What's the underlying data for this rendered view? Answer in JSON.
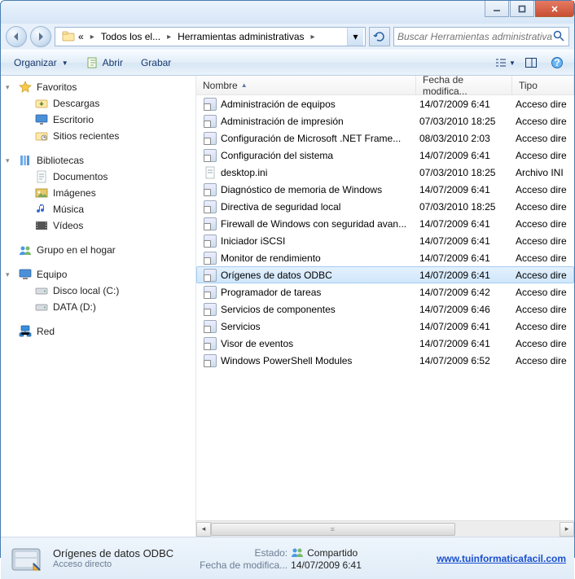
{
  "titlebar": {
    "min": "min",
    "max": "max",
    "close": "close"
  },
  "address": {
    "root_hint": "«",
    "seg1": "Todos los el...",
    "seg2": "Herramientas administrativas"
  },
  "search": {
    "placeholder": "Buscar Herramientas administrativas"
  },
  "toolbar": {
    "organize": "Organizar",
    "open": "Abrir",
    "burn": "Grabar"
  },
  "nav": {
    "favorites": "Favoritos",
    "downloads": "Descargas",
    "desktop": "Escritorio",
    "recent": "Sitios recientes",
    "libraries": "Bibliotecas",
    "documents": "Documentos",
    "images": "Imágenes",
    "music": "Música",
    "videos": "Vídeos",
    "homegroup": "Grupo en el hogar",
    "computer": "Equipo",
    "localdisk": "Disco local (C:)",
    "datad": "DATA (D:)",
    "network": "Red"
  },
  "columns": {
    "name": "Nombre",
    "date": "Fecha de modifica...",
    "type": "Tipo"
  },
  "col_widths": {
    "name": 270,
    "date": 118,
    "type": 80
  },
  "rows": [
    {
      "name": "Administración de equipos",
      "date": "14/07/2009 6:41",
      "type": "Acceso dire"
    },
    {
      "name": "Administración de impresión",
      "date": "07/03/2010 18:25",
      "type": "Acceso dire"
    },
    {
      "name": "Configuración de Microsoft .NET Frame...",
      "date": "08/03/2010 2:03",
      "type": "Acceso dire"
    },
    {
      "name": "Configuración del sistema",
      "date": "14/07/2009 6:41",
      "type": "Acceso dire"
    },
    {
      "name": "desktop.ini",
      "date": "07/03/2010 18:25",
      "type": "Archivo INI",
      "plain": true
    },
    {
      "name": "Diagnóstico de memoria de Windows",
      "date": "14/07/2009 6:41",
      "type": "Acceso dire"
    },
    {
      "name": "Directiva de seguridad local",
      "date": "07/03/2010 18:25",
      "type": "Acceso dire"
    },
    {
      "name": "Firewall de Windows con seguridad avan...",
      "date": "14/07/2009 6:41",
      "type": "Acceso dire"
    },
    {
      "name": "Iniciador iSCSI",
      "date": "14/07/2009 6:41",
      "type": "Acceso dire"
    },
    {
      "name": "Monitor de rendimiento",
      "date": "14/07/2009 6:41",
      "type": "Acceso dire"
    },
    {
      "name": "Orígenes de datos ODBC",
      "date": "14/07/2009 6:41",
      "type": "Acceso dire",
      "selected": true
    },
    {
      "name": "Programador de tareas",
      "date": "14/07/2009 6:42",
      "type": "Acceso dire"
    },
    {
      "name": "Servicios de componentes",
      "date": "14/07/2009 6:46",
      "type": "Acceso dire"
    },
    {
      "name": "Servicios",
      "date": "14/07/2009 6:41",
      "type": "Acceso dire"
    },
    {
      "name": "Visor de eventos",
      "date": "14/07/2009 6:41",
      "type": "Acceso dire"
    },
    {
      "name": "Windows PowerShell Modules",
      "date": "14/07/2009 6:52",
      "type": "Acceso dire"
    }
  ],
  "details": {
    "title": "Orígenes de datos ODBC",
    "sub": "Acceso directo",
    "state_lbl": "Estado:",
    "state_val": "Compartido",
    "date_lbl": "Fecha de modifica...",
    "date_val": "14/07/2009 6:41",
    "link": "www.tuinformaticafacil.com"
  }
}
